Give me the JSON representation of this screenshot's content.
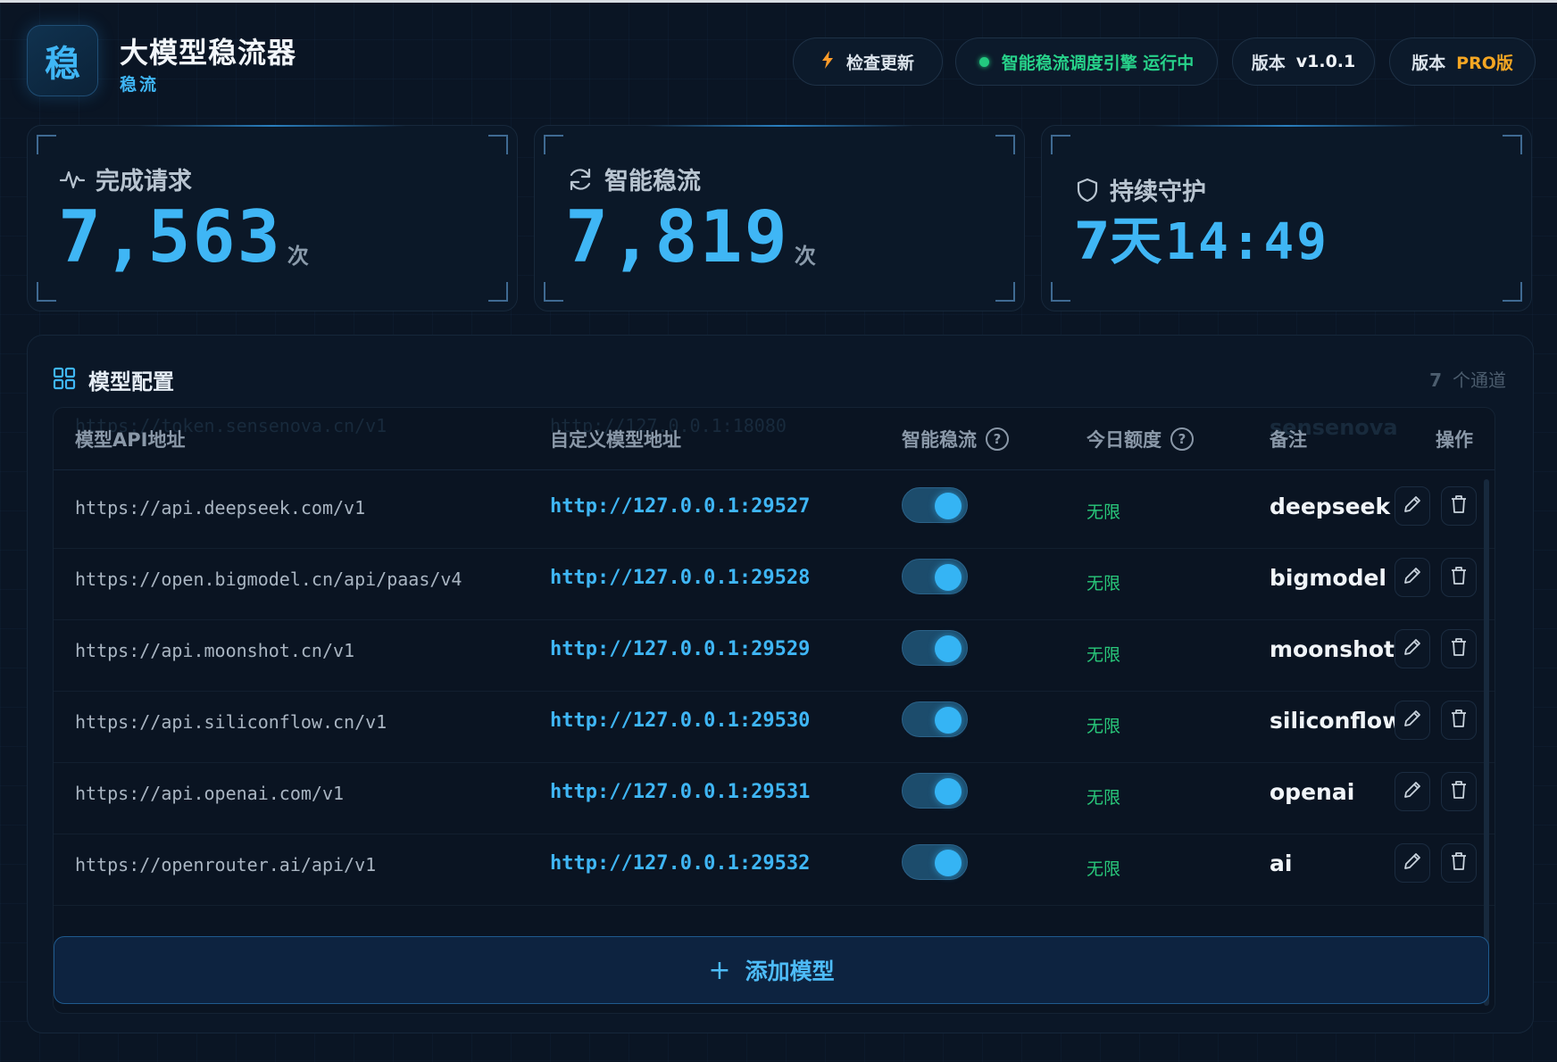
{
  "header": {
    "logo_char": "稳",
    "title": "大模型稳流器",
    "subtitle": "稳流",
    "check_update_label": "检查更新",
    "engine_status": "智能稳流调度引擎 运行中",
    "version_label": "版本",
    "version_value": "v1.0.1",
    "edition_label": "版本",
    "edition_value": "PRO版"
  },
  "stats": {
    "completed": {
      "label": "完成请求",
      "value": "7,563",
      "unit": "次"
    },
    "smart": {
      "label": "智能稳流",
      "value": "7,819",
      "unit": "次"
    },
    "guard": {
      "label": "持续守护",
      "days": "7天",
      "time": "14:49"
    }
  },
  "models": {
    "title": "模型配置",
    "count": "7",
    "count_unit": "个通道",
    "columns": {
      "api": "模型API地址",
      "custom": "自定义模型地址",
      "smart": "智能稳流",
      "quota": "今日额度",
      "note": "备注",
      "actions": "操作"
    },
    "hidden_row": {
      "api": "https://token.sensenova.cn/v1",
      "custom": "http://127.0.0.1:18080",
      "note": "sensenova"
    },
    "rows": [
      {
        "api": "https://api.deepseek.com/v1",
        "custom": "http://127.0.0.1:29527",
        "enabled": true,
        "quota": "无限",
        "note": "deepseek"
      },
      {
        "api": "https://open.bigmodel.cn/api/paas/v4",
        "custom": "http://127.0.0.1:29528",
        "enabled": true,
        "quota": "无限",
        "note": "bigmodel"
      },
      {
        "api": "https://api.moonshot.cn/v1",
        "custom": "http://127.0.0.1:29529",
        "enabled": true,
        "quota": "无限",
        "note": "moonshot"
      },
      {
        "api": "https://api.siliconflow.cn/v1",
        "custom": "http://127.0.0.1:29530",
        "enabled": true,
        "quota": "无限",
        "note": "siliconflow"
      },
      {
        "api": "https://api.openai.com/v1",
        "custom": "http://127.0.0.1:29531",
        "enabled": true,
        "quota": "无限",
        "note": "openai"
      },
      {
        "api": "https://openrouter.ai/api/v1",
        "custom": "http://127.0.0.1:29532",
        "enabled": true,
        "quota": "无限",
        "note": "ai"
      }
    ],
    "add_label": "添加模型",
    "help_mark": "?"
  },
  "icons": {
    "check_update": "lightning-icon",
    "status": "green-dot",
    "completed": "activity-icon",
    "smart": "refresh-icon",
    "guard": "shield-icon",
    "models": "grid-icon",
    "edit": "pencil-icon",
    "delete": "trash-icon",
    "add": "plus-icon"
  },
  "colors": {
    "accent": "#3fb6f5",
    "status_green": "#27d28a",
    "edition_orange": "#f5a623",
    "background": "#0a1524"
  }
}
